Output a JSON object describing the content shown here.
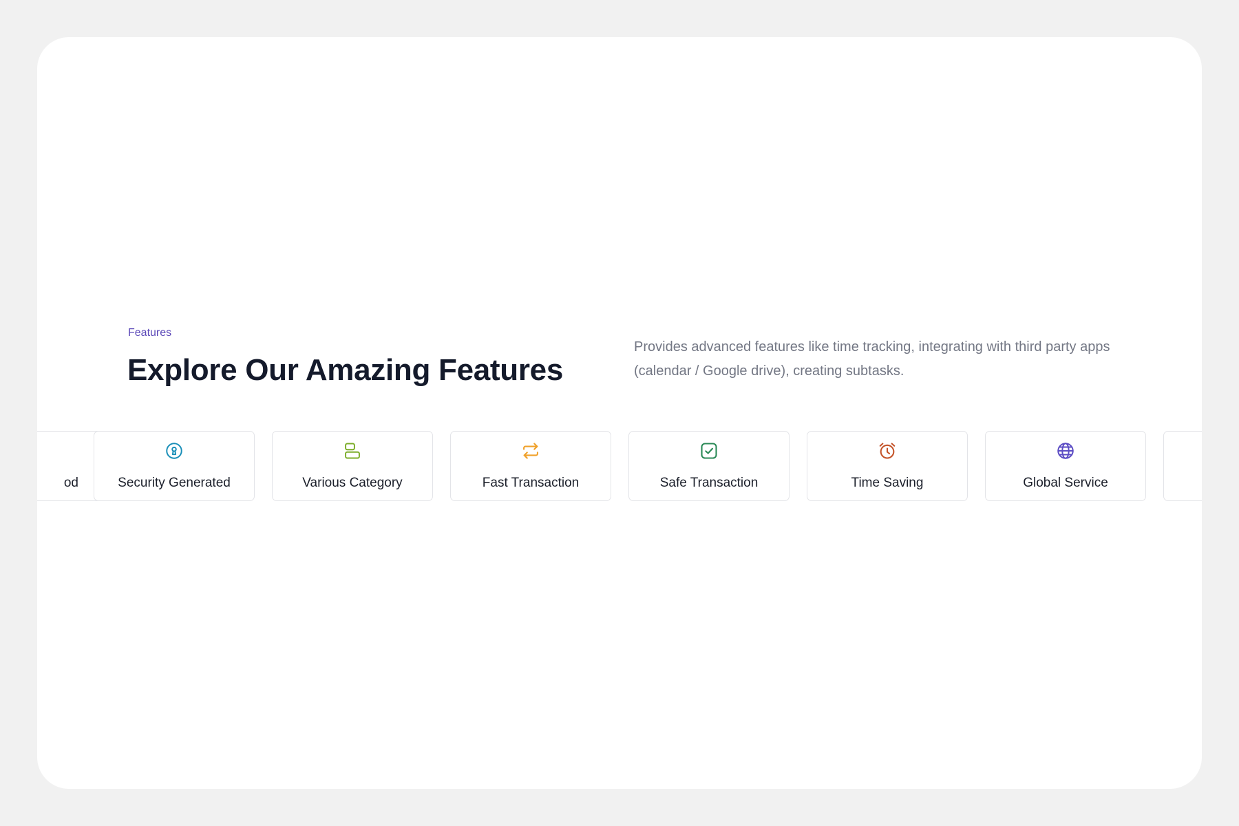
{
  "section": {
    "eyebrow": "Features",
    "title": "Explore Our Amazing Features",
    "description": "Provides advanced features like time tracking, integrating with third party apps (calendar / Google drive), creating subtasks."
  },
  "features": [
    {
      "label": "od",
      "icon": "cut-off-card-icon",
      "color": "#1b1f2a"
    },
    {
      "label": "Security Generated",
      "icon": "keyhole-icon",
      "color": "#1a8fb8"
    },
    {
      "label": "Various Category",
      "icon": "stacked-blocks-icon",
      "color": "#7cad2a"
    },
    {
      "label": "Fast Transaction",
      "icon": "arrows-exchange-icon",
      "color": "#f0a12a"
    },
    {
      "label": "Safe Transaction",
      "icon": "checkbox-icon",
      "color": "#2b8a57"
    },
    {
      "label": "Time Saving",
      "icon": "alarm-clock-icon",
      "color": "#c4542a"
    },
    {
      "label": "Global Service",
      "icon": "globe-icon",
      "color": "#5b4cc4"
    }
  ],
  "colors": {
    "accent": "#5b48b8",
    "heading": "#141a2b",
    "body": "#737784",
    "card_border": "#e3e4e8",
    "page_background": "#f1f1f1"
  }
}
